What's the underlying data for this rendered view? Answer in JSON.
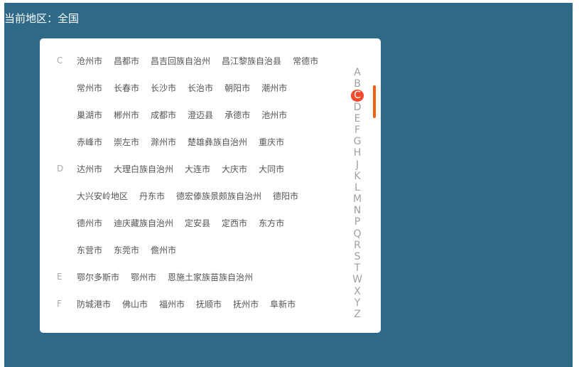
{
  "header": {
    "current_region": "当前地区：全国"
  },
  "groups": [
    {
      "letter": "C",
      "rows": [
        [
          "沧州市",
          "昌都市",
          "昌吉回族自治州",
          "昌江黎族自治县",
          "常德市"
        ],
        [
          "常州市",
          "长春市",
          "长沙市",
          "长治市",
          "朝阳市",
          "潮州市"
        ],
        [
          "巢湖市",
          "郴州市",
          "成都市",
          "澄迈县",
          "承德市",
          "池州市"
        ],
        [
          "赤峰市",
          "崇左市",
          "滁州市",
          "楚雄彝族自治州",
          "重庆市"
        ]
      ]
    },
    {
      "letter": "D",
      "rows": [
        [
          "达州市",
          "大理白族自治州",
          "大连市",
          "大庆市",
          "大同市"
        ],
        [
          "大兴安岭地区",
          "丹东市",
          "德宏傣族景颇族自治州",
          "德阳市"
        ],
        [
          "德州市",
          "迪庆藏族自治州",
          "定安县",
          "定西市",
          "东方市"
        ],
        [
          "东营市",
          "东莞市",
          "儋州市"
        ]
      ]
    },
    {
      "letter": "E",
      "rows": [
        [
          "鄂尔多斯市",
          "鄂州市",
          "恩施土家族苗族自治州"
        ]
      ]
    },
    {
      "letter": "F",
      "rows": [
        [
          "防城港市",
          "佛山市",
          "福州市",
          "抚顺市",
          "抚州市",
          "阜新市"
        ]
      ]
    }
  ],
  "index": {
    "letters": [
      "A",
      "B",
      "C",
      "D",
      "E",
      "F",
      "G",
      "H",
      "J",
      "K",
      "L",
      "M",
      "N",
      "P",
      "Q",
      "R",
      "S",
      "T",
      "W",
      "X",
      "Y",
      "Z"
    ],
    "active": "C"
  },
  "colors": {
    "background": "#2e6a87",
    "panel": "#ffffff",
    "accent": "#f04b2d",
    "scroll_thumb": "#f06010"
  }
}
